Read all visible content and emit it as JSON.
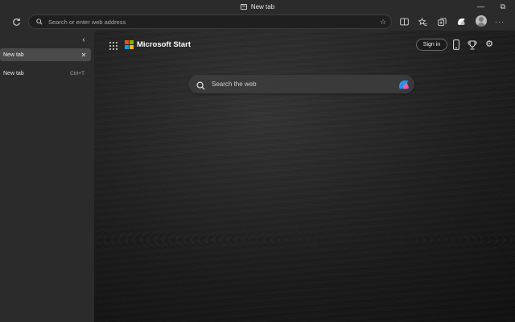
{
  "window": {
    "title": "New tab",
    "minimize_glyph": "—",
    "restore_glyph": "⧉"
  },
  "toolbar": {
    "refresh_icon": "refresh-icon",
    "address_placeholder": "Search or enter web address",
    "favorite_icon": "star-icon",
    "buttons": [
      "split-screen-icon",
      "favorites-icon",
      "collections-icon",
      "copilot-icon",
      "profile-avatar",
      "more-icon"
    ],
    "more_glyph": "···"
  },
  "sidebar": {
    "collapse_glyph": "‹",
    "tabs": [
      {
        "label": "New tab",
        "close_glyph": "✕"
      }
    ],
    "new_tab": {
      "label": "New tab",
      "shortcut": "Ctrl+T"
    }
  },
  "page": {
    "brand": "Microsoft Start",
    "sign_in": "Sign in",
    "search_placeholder": "Search the web",
    "settings_glyph": "⚙",
    "logo_colors": [
      "#f25022",
      "#7fba00",
      "#00a4ef",
      "#ffb900"
    ],
    "background_style": "dark wood texture"
  }
}
